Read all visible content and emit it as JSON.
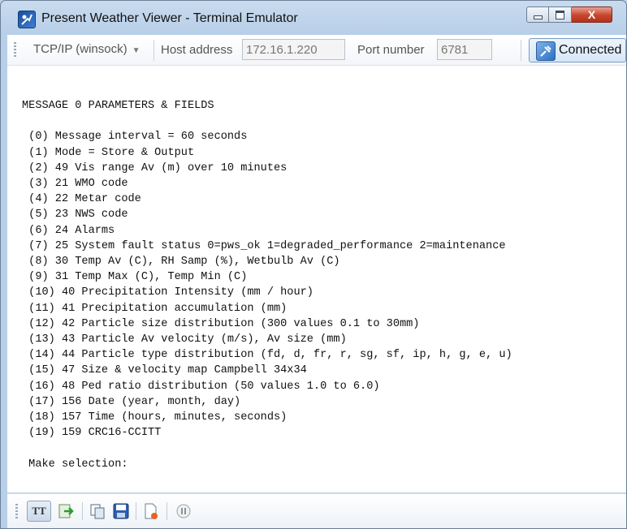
{
  "window": {
    "title": "Present Weather Viewer - Terminal Emulator",
    "close_glyph": "X"
  },
  "toolbar": {
    "protocol": "TCP/IP (winsock)",
    "host_label": "Host address",
    "host_value": "172.16.1.220",
    "port_label": "Port number",
    "port_value": "6781",
    "connect_label": "Connected"
  },
  "terminal": {
    "lines": [
      "MESSAGE 0 PARAMETERS & FIELDS",
      "",
      " (0) Message interval = 60 seconds",
      " (1) Mode = Store & Output",
      " (2) 49 Vis range Av (m) over 10 minutes",
      " (3) 21 WMO code",
      " (4) 22 Metar code",
      " (5) 23 NWS code",
      " (6) 24 Alarms",
      " (7) 25 System fault status 0=pws_ok 1=degraded_performance 2=maintenance",
      " (8) 30 Temp Av (C), RH Samp (%), Wetbulb Av (C)",
      " (9) 31 Temp Max (C), Temp Min (C)",
      " (10) 40 Precipitation Intensity (mm / hour)",
      " (11) 41 Precipitation accumulation (mm)",
      " (12) 42 Particle size distribution (300 values 0.1 to 30mm)",
      " (13) 43 Particle Av velocity (m/s), Av size (mm)",
      " (14) 44 Particle type distribution (fd, d, fr, r, sg, sf, ip, h, g, e, u)",
      " (15) 47 Size & velocity map Campbell 34x34",
      " (16) 48 Ped ratio distribution (50 values 1.0 to 6.0)",
      " (17) 156 Date (year, month, day)",
      " (18) 157 Time (hours, minutes, seconds)",
      " (19) 159 CRC16-CCITT",
      "",
      " Make selection:"
    ]
  },
  "statusbar": {
    "tt_label": "TT"
  }
}
